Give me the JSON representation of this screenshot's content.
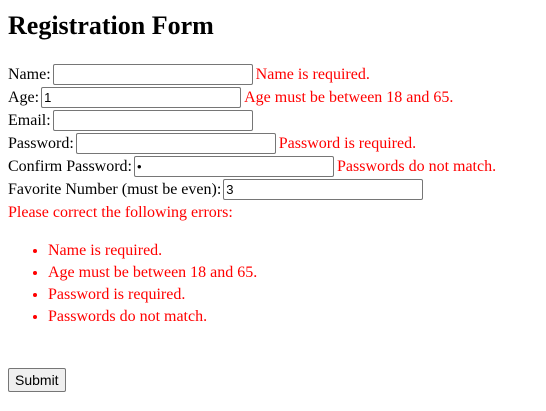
{
  "page": {
    "title": "Registration Form"
  },
  "form": {
    "name": {
      "label": "Name:",
      "value": "",
      "error": "Name is required."
    },
    "age": {
      "label": "Age:",
      "value": "1",
      "error": "Age must be between 18 and 65."
    },
    "email": {
      "label": "Email:",
      "value": "",
      "error": ""
    },
    "password": {
      "label": "Password:",
      "value": "",
      "error": "Password is required."
    },
    "confirm_password": {
      "label": "Confirm Password:",
      "value": "•",
      "error": "Passwords do not match."
    },
    "favorite_number": {
      "label": "Favorite Number (must be even):",
      "value": "3",
      "error": ""
    }
  },
  "summary": {
    "title": "Please correct the following errors:",
    "items": [
      "Name is required.",
      "Age must be between 18 and 65.",
      "Password is required.",
      "Passwords do not match."
    ]
  },
  "actions": {
    "submit_label": "Submit"
  },
  "colors": {
    "error": "#ff0000",
    "text": "#000000"
  }
}
